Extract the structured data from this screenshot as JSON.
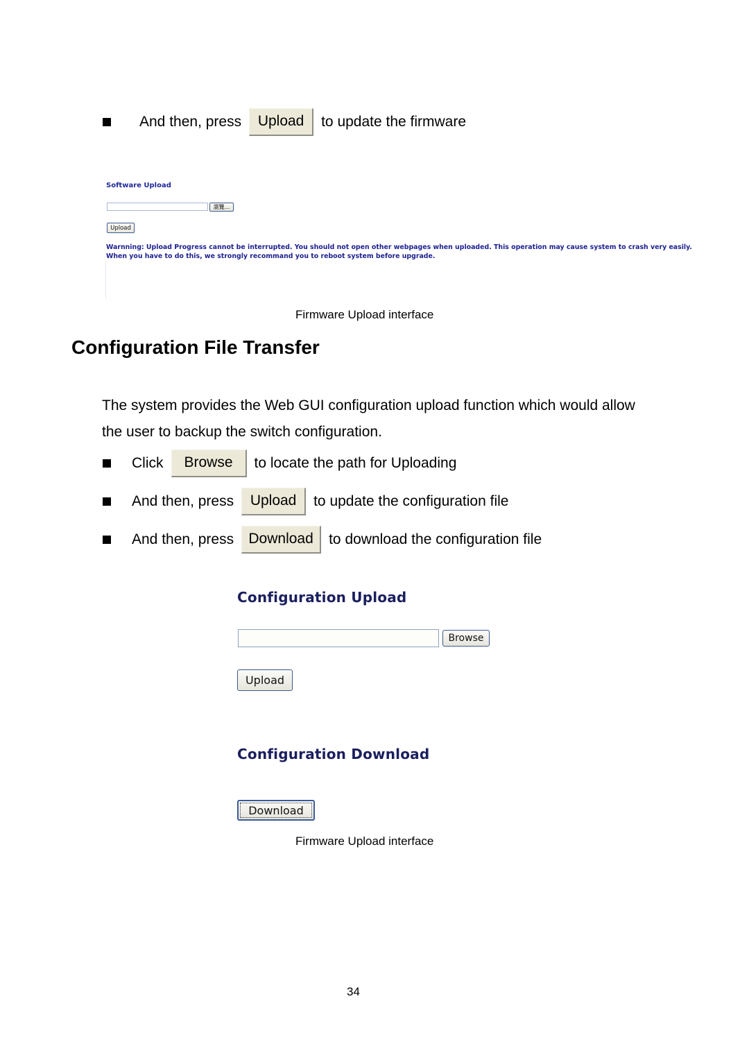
{
  "step_firmware": {
    "prefix": "And then, press",
    "button": "Upload",
    "suffix": "to update the firmware"
  },
  "firmware_screenshot": {
    "title": "Software Upload",
    "file_input_value": "",
    "browse_button": "瀏覽...",
    "upload_button": "Upload",
    "warning_line1": "Warnning: Upload Progress cannot be interrupted. You should not open other webpages when uploaded. This operation may cause system to crash very easily.",
    "warning_line2": "When you have to do this, we strongly recommand you to reboot system before upgrade."
  },
  "caption1": "Firmware Upload interface",
  "section": {
    "heading": "Configuration File Transfer",
    "paragraph_line1": "The system provides the Web GUI configuration upload function which would allow",
    "paragraph_line2": "the user to backup the switch configuration."
  },
  "steps": [
    {
      "prefix": "Click",
      "button": "Browse",
      "suffix": "to locate the path for Uploading"
    },
    {
      "prefix": "And then, press",
      "button": "Upload",
      "suffix": "to update the configuration file"
    },
    {
      "prefix": "And then, press",
      "button": "Download",
      "suffix": "to download the configuration file"
    }
  ],
  "config_screenshot": {
    "upload_title": "Configuration Upload",
    "file_input_value": "",
    "browse_button": "Browse",
    "upload_button": "Upload",
    "download_title": "Configuration Download",
    "download_button": "Download"
  },
  "caption2": "Firmware Upload interface",
  "page_number": "34"
}
